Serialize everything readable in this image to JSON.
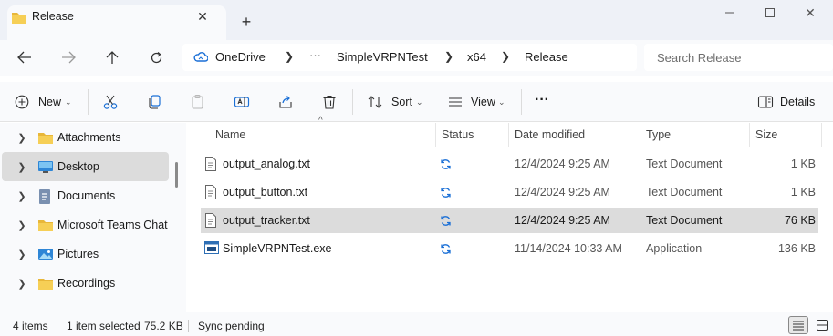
{
  "window": {
    "tab_title": "Release",
    "colors": {
      "folder": "#f3c744",
      "sync": "#1a6fd6",
      "selection": "#dcdcdc",
      "chrome": "#eef1f7"
    }
  },
  "address": {
    "crumbs": [
      "OneDrive",
      "SimpleVRPNTest",
      "x64",
      "Release"
    ],
    "overflow": "···",
    "search_placeholder": "Search Release"
  },
  "commands": {
    "new": "New",
    "sort": "Sort",
    "view": "View",
    "more": "···",
    "details": "Details"
  },
  "nav": {
    "items": [
      {
        "label": "Attachments",
        "icon": "folder-icon",
        "selected": false
      },
      {
        "label": "Desktop",
        "icon": "desktop-icon",
        "selected": true
      },
      {
        "label": "Documents",
        "icon": "documents-icon",
        "selected": false
      },
      {
        "label": "Microsoft Teams Chat Files",
        "icon": "folder-icon",
        "selected": false
      },
      {
        "label": "Pictures",
        "icon": "pictures-icon",
        "selected": false
      },
      {
        "label": "Recordings",
        "icon": "folder-icon",
        "selected": false
      }
    ]
  },
  "files": {
    "headers": {
      "name": "Name",
      "status": "Status",
      "date": "Date modified",
      "type": "Type",
      "size": "Size"
    },
    "rows": [
      {
        "name": "output_analog.txt",
        "date": "12/4/2024 9:25 AM",
        "type": "Text Document",
        "size": "1 KB",
        "icon": "text-file-icon",
        "selected": false
      },
      {
        "name": "output_button.txt",
        "date": "12/4/2024 9:25 AM",
        "type": "Text Document",
        "size": "1 KB",
        "icon": "text-file-icon",
        "selected": false
      },
      {
        "name": "output_tracker.txt",
        "date": "12/4/2024 9:25 AM",
        "type": "Text Document",
        "size": "76 KB",
        "icon": "text-file-icon",
        "selected": true
      },
      {
        "name": "SimpleVRPNTest.exe",
        "date": "11/14/2024 10:33 AM",
        "type": "Application",
        "size": "136 KB",
        "icon": "exe-icon",
        "selected": false
      }
    ]
  },
  "status": {
    "count": "4 items",
    "selected": "1 item selected",
    "size": "75.2 KB",
    "sync": "Sync pending"
  }
}
